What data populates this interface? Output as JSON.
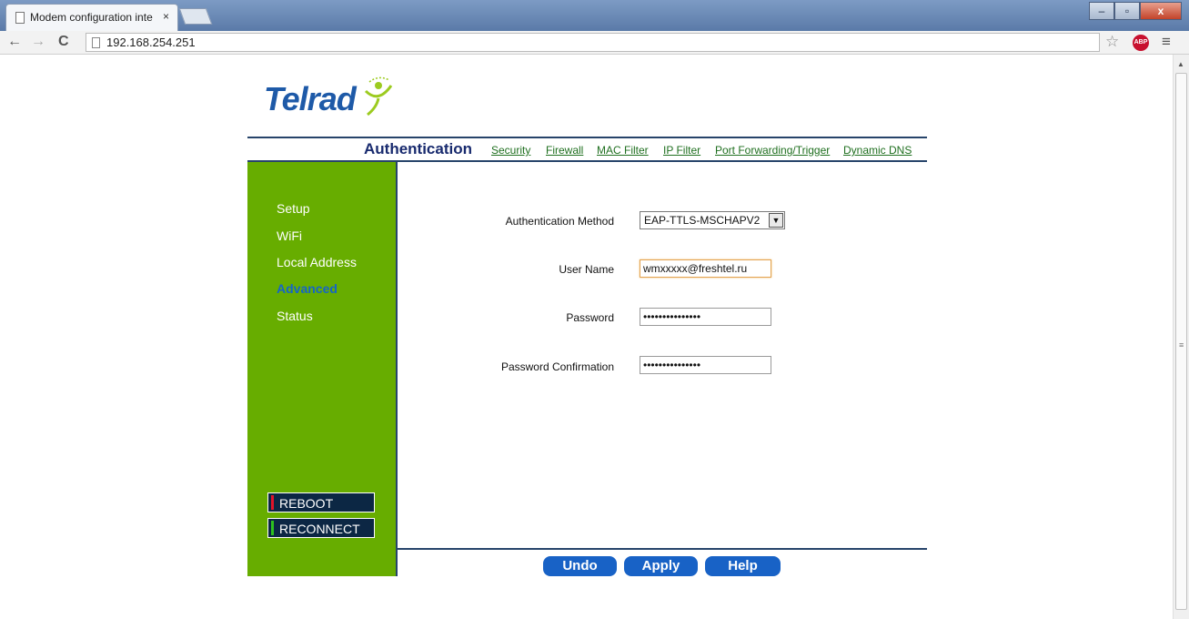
{
  "browser": {
    "tab_title": "Modem configuration inte",
    "tab_close": "×",
    "address": "192.168.254.251",
    "back": "←",
    "forward": "→",
    "reload": "C",
    "bookmark": "☆",
    "adblock": "ABP",
    "menu": "≡",
    "window_minimize": "–",
    "window_maximize": "▫",
    "window_close": "x"
  },
  "logo": {
    "text": "Telrad"
  },
  "nav": {
    "active": "Authentication",
    "links": [
      "Security",
      "Firewall",
      "MAC Filter",
      "IP Filter",
      "Port Forwarding/Trigger",
      "Dynamic DNS"
    ]
  },
  "sidebar": {
    "items": [
      "Setup",
      "WiFi",
      "Local Address",
      "Advanced",
      "Status"
    ],
    "active_item": "Advanced",
    "reboot_label": "REBOOT",
    "reconnect_label": "RECONNECT"
  },
  "form": {
    "auth_method_label": "Authentication Method",
    "auth_method_value": "EAP-TTLS-MSCHAPV2",
    "username_label": "User Name",
    "username_value": "wmxxxxx@freshtel.ru",
    "password_label": "Password",
    "password_value": "•••••••••••••••",
    "password_confirm_label": "Password Confirmation",
    "password_confirm_value": "•••••••••••••••"
  },
  "actions": {
    "undo": "Undo",
    "apply": "Apply",
    "help": "Help"
  },
  "colors": {
    "sidebar_green": "#67ad00",
    "nav_blue": "#182a6e",
    "link_green": "#1f6f1f",
    "button_blue": "#1862c6",
    "reboot_mark": "#e0142a",
    "reconnect_mark": "#2ec21f"
  }
}
